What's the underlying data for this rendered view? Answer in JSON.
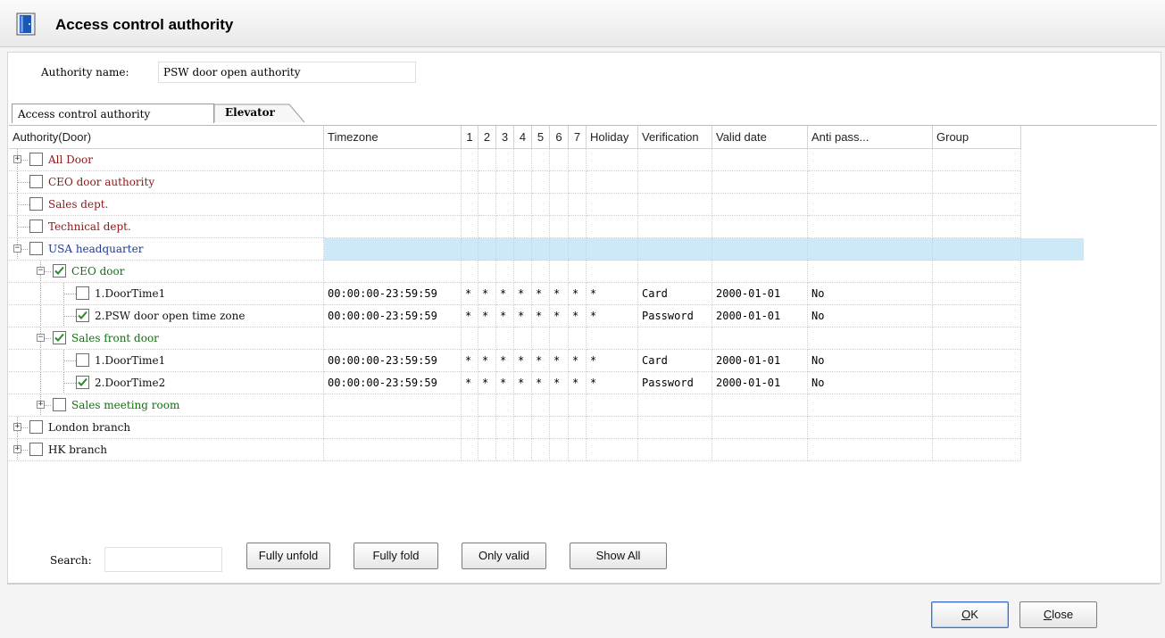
{
  "window": {
    "title": "Access control authority"
  },
  "authority": {
    "label": "Authority name:",
    "value": "PSW door open authority"
  },
  "tabs": [
    {
      "label": "Access control authority",
      "active": true
    },
    {
      "label": "Elevator",
      "active": false
    }
  ],
  "columns": [
    "Authority(Door)",
    "Timezone",
    "1",
    "2",
    "3",
    "4",
    "5",
    "6",
    "7",
    "Holiday",
    "Verification",
    "Valid date",
    "Anti pass...",
    "Group"
  ],
  "rows": [
    {
      "label": "All Door",
      "level": 0,
      "expander": "+",
      "checked": false,
      "color": "red"
    },
    {
      "label": "CEO door authority",
      "level": 0,
      "expander": "",
      "checked": false,
      "color": "red"
    },
    {
      "label": "Sales dept.",
      "level": 0,
      "expander": "",
      "checked": false,
      "color": "red"
    },
    {
      "label": "Technical dept.",
      "level": 0,
      "expander": "",
      "checked": false,
      "color": "red"
    },
    {
      "label": "USA headquarter",
      "level": 0,
      "expander": "-",
      "checked": false,
      "color": "navy",
      "selected": true
    },
    {
      "label": "CEO door",
      "level": 1,
      "expander": "-",
      "checked": true,
      "color": "green"
    },
    {
      "label": "1.DoorTime1",
      "level": 2,
      "expander": "",
      "checked": false,
      "color": "blk",
      "timezone": "00:00:00-23:59:59",
      "days": [
        "*",
        "*",
        "*",
        "*",
        "*",
        "*",
        "*"
      ],
      "holiday": "*",
      "verification": "Card",
      "valid_date": "2000-01-01",
      "anti_pass": "No"
    },
    {
      "label": "2.PSW door open time zone",
      "level": 2,
      "expander": "",
      "checked": true,
      "color": "blk",
      "timezone": "00:00:00-23:59:59",
      "days": [
        "*",
        "*",
        "*",
        "*",
        "*",
        "*",
        "*"
      ],
      "holiday": "*",
      "verification": "Password",
      "valid_date": "2000-01-01",
      "anti_pass": "No"
    },
    {
      "label": "Sales front door",
      "level": 1,
      "expander": "-",
      "checked": true,
      "color": "green"
    },
    {
      "label": "1.DoorTime1",
      "level": 2,
      "expander": "",
      "checked": false,
      "color": "blk",
      "timezone": "00:00:00-23:59:59",
      "days": [
        "*",
        "*",
        "*",
        "*",
        "*",
        "*",
        "*"
      ],
      "holiday": "*",
      "verification": "Card",
      "valid_date": "2000-01-01",
      "anti_pass": "No"
    },
    {
      "label": "2.DoorTime2",
      "level": 2,
      "expander": "",
      "checked": true,
      "color": "blk",
      "timezone": "00:00:00-23:59:59",
      "days": [
        "*",
        "*",
        "*",
        "*",
        "*",
        "*",
        "*"
      ],
      "holiday": "*",
      "verification": "Password",
      "valid_date": "2000-01-01",
      "anti_pass": "No"
    },
    {
      "label": "Sales meeting room",
      "level": 1,
      "expander": "+",
      "checked": false,
      "color": "green"
    },
    {
      "label": "London branch",
      "level": 0,
      "expander": "+",
      "checked": false,
      "color": "blk"
    },
    {
      "label": "HK branch",
      "level": 0,
      "expander": "+",
      "checked": false,
      "color": "blk"
    }
  ],
  "search": {
    "label": "Search:",
    "value": ""
  },
  "buttons": {
    "fully_unfold": "Fully unfold",
    "fully_fold": "Fully fold",
    "only_valid": "Only valid",
    "show_all": "Show All",
    "ok_accel": "O",
    "ok_rest": "K",
    "close_accel": "C",
    "close_rest": "lose"
  },
  "colors": {
    "selected_row": "#cde9f9",
    "red_label": "#8a1818",
    "navy_label": "#1f3a8a",
    "green_label": "#127012",
    "check": "#2a8a2a"
  }
}
